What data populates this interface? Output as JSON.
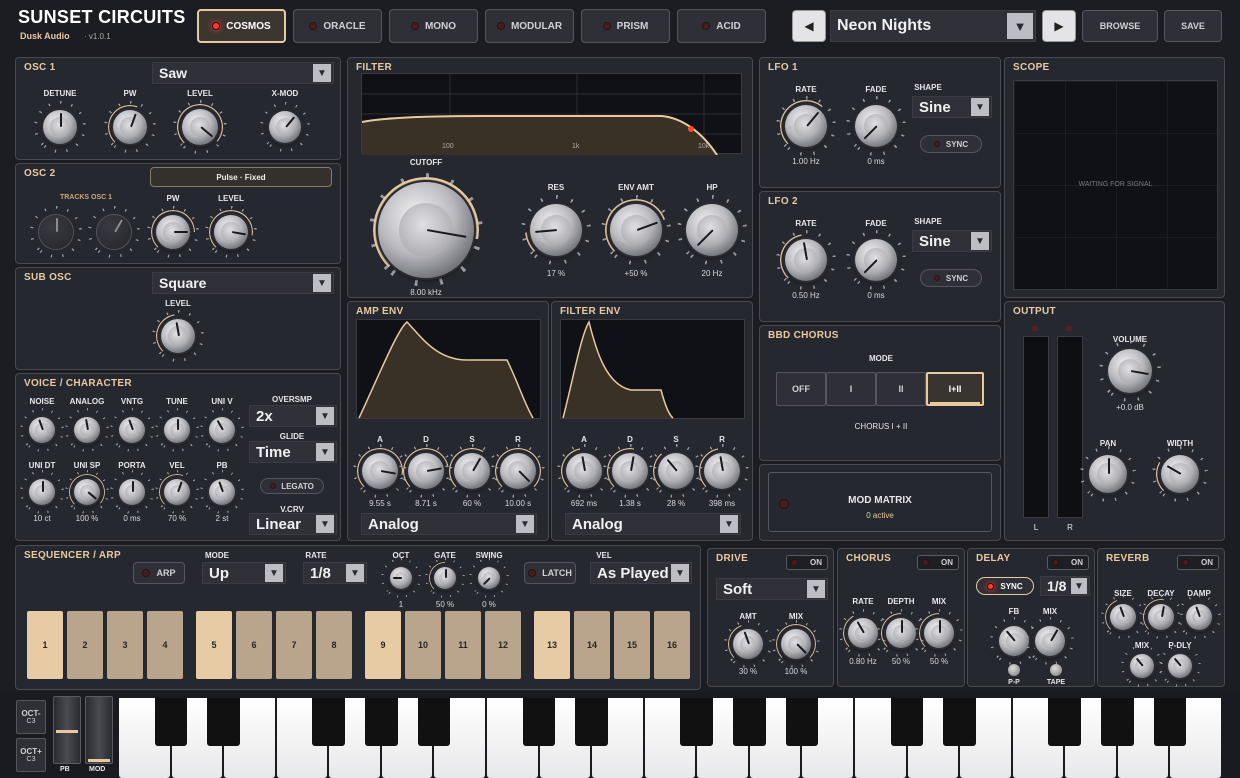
{
  "header": {
    "title": "SUNSET CIRCUITS",
    "brand": "Dusk Audio",
    "version": "· v1.0.1",
    "engines": [
      "COSMOS",
      "ORACLE",
      "MONO",
      "MODULAR",
      "PRISM",
      "ACID"
    ],
    "active_engine": "COSMOS",
    "preset": "Neon Nights",
    "browse": "BROWSE",
    "save": "SAVE"
  },
  "osc1": {
    "title": "OSC 1",
    "wave": "Saw",
    "knobs": [
      "DETUNE",
      "PW",
      "LEVEL",
      "X-MOD"
    ]
  },
  "osc2": {
    "title": "OSC 2",
    "mode": "Pulse · Fixed",
    "tracks": "TRACKS OSC 1",
    "knobs": [
      "PW",
      "LEVEL"
    ]
  },
  "sub": {
    "title": "SUB OSC",
    "wave": "Square",
    "level": "LEVEL"
  },
  "voice": {
    "title": "VOICE / CHARACTER",
    "row1": [
      "NOISE",
      "ANALOG",
      "VNTG",
      "TUNE",
      "UNI V"
    ],
    "row2": [
      {
        "l": "UNI DT",
        "v": "10 ct"
      },
      {
        "l": "UNI SP",
        "v": "100 %"
      },
      {
        "l": "PORTA",
        "v": "0 ms"
      },
      {
        "l": "VEL",
        "v": "70 %"
      },
      {
        "l": "PB",
        "v": "2 st"
      }
    ],
    "oversmp": "OVERSMP",
    "oversmp_val": "2x",
    "glide": "GLIDE",
    "glide_val": "Time",
    "legato": "LEGATO",
    "vcrv": "V.CRV",
    "vcrv_val": "Linear"
  },
  "filter": {
    "title": "FILTER",
    "freqs": [
      "100",
      "1k",
      "10k"
    ],
    "cutoff": {
      "l": "CUTOFF",
      "v": "8.00 kHz"
    },
    "knobs": [
      {
        "l": "RES",
        "v": "17 %"
      },
      {
        "l": "ENV AMT",
        "v": "+50 %"
      },
      {
        "l": "HP",
        "v": "20 Hz"
      }
    ]
  },
  "ampenv": {
    "title": "AMP ENV",
    "knobs": [
      {
        "l": "A",
        "v": "9.55 s"
      },
      {
        "l": "D",
        "v": "8.71 s"
      },
      {
        "l": "S",
        "v": "60 %"
      },
      {
        "l": "R",
        "v": "10.00 s"
      }
    ],
    "type": "Analog"
  },
  "filtenv": {
    "title": "FILTER ENV",
    "knobs": [
      {
        "l": "A",
        "v": "692 ms"
      },
      {
        "l": "D",
        "v": "1.38 s"
      },
      {
        "l": "S",
        "v": "28 %"
      },
      {
        "l": "R",
        "v": "398 ms"
      }
    ],
    "type": "Analog"
  },
  "lfo1": {
    "title": "LFO 1",
    "rate": "RATE",
    "rate_v": "1.00 Hz",
    "fade": "FADE",
    "fade_v": "0 ms",
    "shape": "SHAPE",
    "shape_v": "Sine",
    "sync": "SYNC"
  },
  "lfo2": {
    "title": "LFO 2",
    "rate": "RATE",
    "rate_v": "0.50 Hz",
    "fade": "FADE",
    "fade_v": "0 ms",
    "shape": "SHAPE",
    "shape_v": "Sine",
    "sync": "SYNC"
  },
  "chorus_bbd": {
    "title": "BBD CHORUS",
    "mode": "MODE",
    "modes": [
      "OFF",
      "I",
      "II",
      "I+II"
    ],
    "active": "I+II",
    "status": "CHORUS I + II"
  },
  "modmatrix": {
    "title": "MOD MATRIX",
    "status": "0 active"
  },
  "scope": {
    "title": "SCOPE",
    "status": "WAITING FOR SIGNAL"
  },
  "output": {
    "title": "OUTPUT",
    "volume": "VOLUME",
    "volume_v": "+0.0 dB",
    "pan": "PAN",
    "width": "WIDTH",
    "l": "L",
    "r": "R"
  },
  "seq": {
    "title": "SEQUENCER / ARP",
    "arp": "ARP",
    "mode": "MODE",
    "mode_v": "Up",
    "rate": "RATE",
    "rate_v": "1/8",
    "oct": "OCT",
    "oct_v": "1",
    "gate": "GATE",
    "gate_v": "50 %",
    "swing": "SWING",
    "swing_v": "0 %",
    "latch": "LATCH",
    "vel": "VEL",
    "vel_v": "As Played",
    "steps": [
      "1",
      "2",
      "3",
      "4",
      "5",
      "6",
      "7",
      "8",
      "9",
      "10",
      "11",
      "12",
      "13",
      "14",
      "15",
      "16"
    ]
  },
  "drive": {
    "title": "DRIVE",
    "on": "ON",
    "type": "Soft",
    "amt": "AMT",
    "amt_v": "30 %",
    "mix": "MIX",
    "mix_v": "100 %"
  },
  "chorus": {
    "title": "CHORUS",
    "on": "ON",
    "rate": "RATE",
    "rate_v": "0.80 Hz",
    "depth": "DEPTH",
    "depth_v": "50 %",
    "mix": "MIX",
    "mix_v": "50 %"
  },
  "delay": {
    "title": "DELAY",
    "on": "ON",
    "sync": "SYNC",
    "time": "1/8",
    "fb": "FB",
    "mix": "MIX",
    "pp": "P-P",
    "tape": "TAPE"
  },
  "reverb": {
    "title": "REVERB",
    "on": "ON",
    "size": "SIZE",
    "decay": "DECAY",
    "damp": "DAMP",
    "mix": "MIX",
    "pdly": "P-DLY"
  },
  "keyboard": {
    "octdown": "OCT-",
    "octdown_v": "C3",
    "octup": "OCT+",
    "octup_v": "C3",
    "pb": "PB",
    "mod": "MOD"
  },
  "colors": {
    "accent": "#e8c9a0",
    "led": "#ff3a2a",
    "panel": "#262830"
  }
}
